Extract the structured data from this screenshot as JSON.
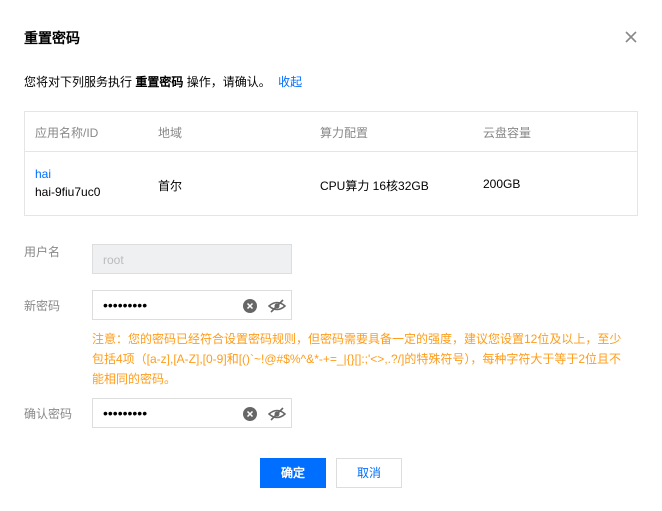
{
  "dialog": {
    "title": "重置密码",
    "description_prefix": "您将对下列服务执行",
    "description_action": "重置密码",
    "description_suffix": "操作，请确认。",
    "collapse_link": "收起"
  },
  "table": {
    "headers": [
      "应用名称/ID",
      "地域",
      "算力配置",
      "云盘容量"
    ],
    "row": {
      "app_name": "hai",
      "app_id": "hai-9fiu7uc0",
      "region": "首尔",
      "compute": "CPU算力 16核32GB",
      "disk": "200GB"
    }
  },
  "form": {
    "username_label": "用户名",
    "username_value": "root",
    "new_password_label": "新密码",
    "new_password_value": "•••••••••",
    "confirm_password_label": "确认密码",
    "confirm_password_value": "•••••••••",
    "notice": "注意：您的密码已经符合设置密码规则，但密码需要具备一定的强度，建议您设置12位及以上，至少包括4项（[a-z],[A-Z],[0-9]和[()`~!@#$%^&*-+=_|{}[]:;'<>,.?/]的特殊符号），每种字符大于等于2位且不能相同的密码。"
  },
  "buttons": {
    "confirm": "确定",
    "cancel": "取消"
  },
  "colors": {
    "accent": "#006eff",
    "warning": "#ff9c19",
    "muted": "#888888"
  }
}
